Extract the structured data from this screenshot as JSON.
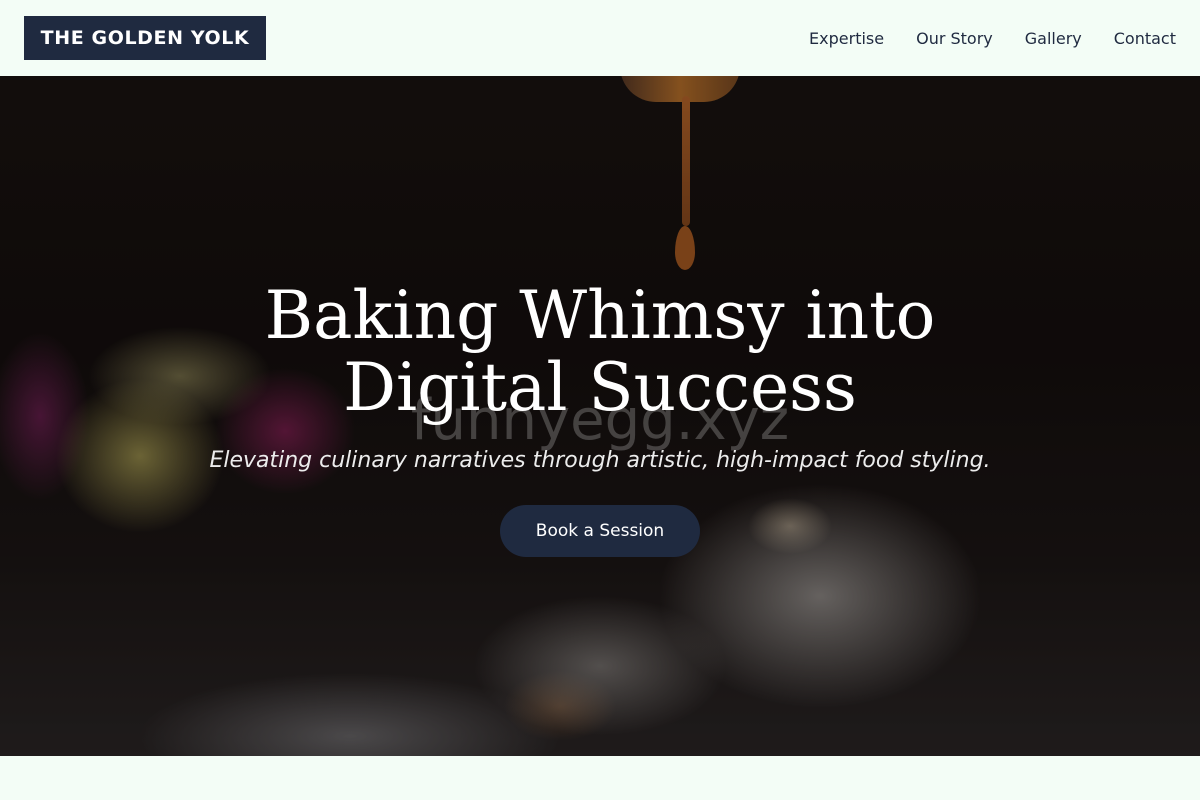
{
  "brand": {
    "logo_text": "THE GOLDEN YOLK"
  },
  "nav": {
    "links": [
      {
        "label": "Expertise"
      },
      {
        "label": "Our Story"
      },
      {
        "label": "Gallery"
      },
      {
        "label": "Contact"
      }
    ]
  },
  "hero": {
    "title": "Baking Whimsy into Digital Success",
    "subtitle": "Elevating culinary narratives through artistic, high-impact food styling.",
    "cta_label": "Book a Session",
    "watermark": "funnyegg.xyz"
  },
  "colors": {
    "background": "#f3fdf6",
    "primary": "#1f2a40",
    "text_on_primary": "#ffffff"
  }
}
